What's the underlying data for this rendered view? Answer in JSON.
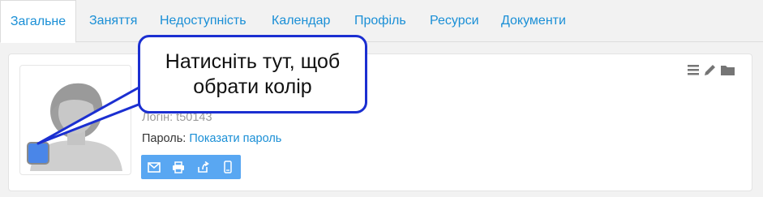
{
  "tabs": [
    {
      "label": "Загальне"
    },
    {
      "label": "Заняття"
    },
    {
      "label": "Недоступність"
    },
    {
      "label": "Календар"
    },
    {
      "label": "Профіль"
    },
    {
      "label": "Ресурси"
    },
    {
      "label": "Документи"
    }
  ],
  "active_tab_index": 0,
  "profile": {
    "login_label": "Логін:",
    "login_value": "t50143",
    "password_label": "Пароль:",
    "password_link": "Показати пароль",
    "swatch_color": "#4a86e8"
  },
  "action_icons": [
    "envelope-icon",
    "printer-icon",
    "share-icon",
    "mobile-icon"
  ],
  "card_tool_icons": [
    "list-icon",
    "pencil-icon",
    "folder-icon"
  ],
  "callout": {
    "line1": "Натисніть тут, щоб",
    "line2": "обрати колір"
  },
  "colors": {
    "accent": "#1a8fd6",
    "callout_border": "#1b2fd1",
    "action_bar": "#59a7f2"
  }
}
